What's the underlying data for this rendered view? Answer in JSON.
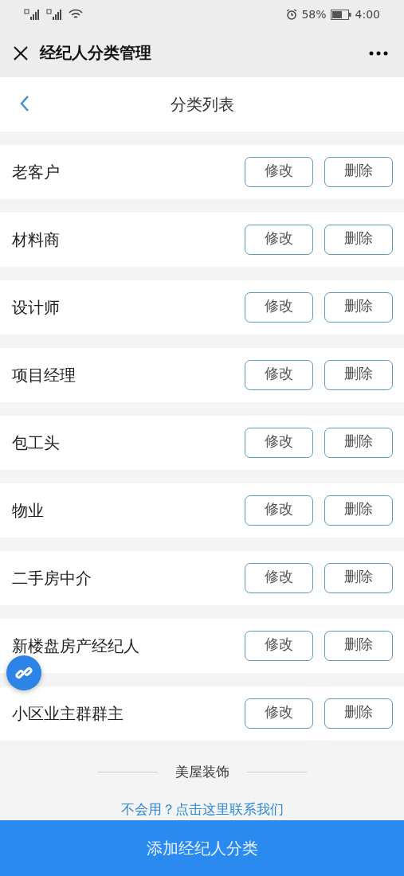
{
  "status_bar": {
    "battery": "58%",
    "time": "4:00"
  },
  "nav": {
    "title": "经纪人分类管理"
  },
  "header": {
    "title": "分类列表"
  },
  "categories": [
    {
      "name": "老客户",
      "edit": "修改",
      "delete": "删除"
    },
    {
      "name": "材料商",
      "edit": "修改",
      "delete": "删除"
    },
    {
      "name": "设计师",
      "edit": "修改",
      "delete": "删除"
    },
    {
      "name": "项目经理",
      "edit": "修改",
      "delete": "删除"
    },
    {
      "name": "包工头",
      "edit": "修改",
      "delete": "删除"
    },
    {
      "name": "物业",
      "edit": "修改",
      "delete": "删除"
    },
    {
      "name": "二手房中介",
      "edit": "修改",
      "delete": "删除"
    },
    {
      "name": "新楼盘房产经纪人",
      "edit": "修改",
      "delete": "删除"
    },
    {
      "name": "小区业主群群主",
      "edit": "修改",
      "delete": "删除"
    }
  ],
  "footer": {
    "brand": "美屋装饰",
    "help_link": "不会用？点击这里联系我们"
  },
  "add_button": "添加经纪人分类"
}
